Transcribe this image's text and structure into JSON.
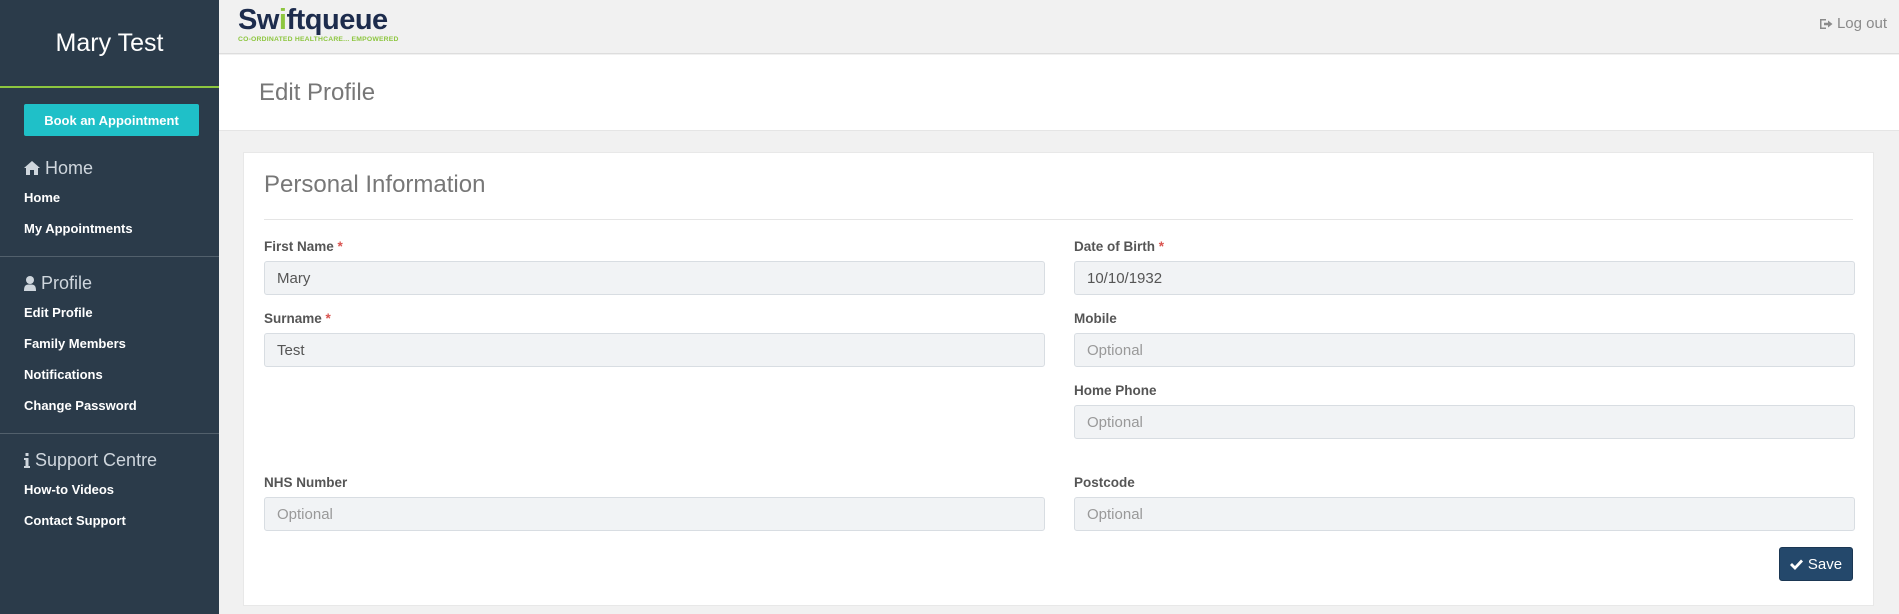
{
  "sidebar": {
    "user_name": "Mary Test",
    "book_button": "Book an Appointment",
    "sections": {
      "home": {
        "title": "Home",
        "items": [
          "Home",
          "My Appointments"
        ]
      },
      "profile": {
        "title": "Profile",
        "items": [
          "Edit Profile",
          "Family Members",
          "Notifications",
          "Change Password"
        ]
      },
      "support": {
        "title": "Support Centre",
        "items": [
          "How-to Videos",
          "Contact Support"
        ]
      }
    }
  },
  "topbar": {
    "logo_text_a": "Sw",
    "logo_text_b": "i",
    "logo_text_c": "ftqueue",
    "logo_tagline": "CO-ORDINATED HEALTHCARE... EMPOWERED",
    "logout_label": "Log out"
  },
  "page": {
    "title": "Edit Profile"
  },
  "form": {
    "section_title": "Personal Information",
    "required_mark": "*",
    "first_name": {
      "label": "First Name",
      "value": "Mary"
    },
    "surname": {
      "label": "Surname",
      "value": "Test"
    },
    "dob": {
      "label": "Date of Birth",
      "value": "10/10/1932"
    },
    "mobile": {
      "label": "Mobile",
      "placeholder": "Optional"
    },
    "home_phone": {
      "label": "Home Phone",
      "placeholder": "Optional"
    },
    "nhs_number": {
      "label": "NHS Number",
      "placeholder": "Optional"
    },
    "postcode": {
      "label": "Postcode",
      "placeholder": "Optional"
    },
    "save_label": "Save"
  },
  "colors": {
    "sidebar_bg": "#2b3b4a",
    "accent_teal": "#1fc0c8",
    "accent_green": "#8dc63f",
    "save_btn": "#24486b",
    "required": "#d9534f"
  }
}
